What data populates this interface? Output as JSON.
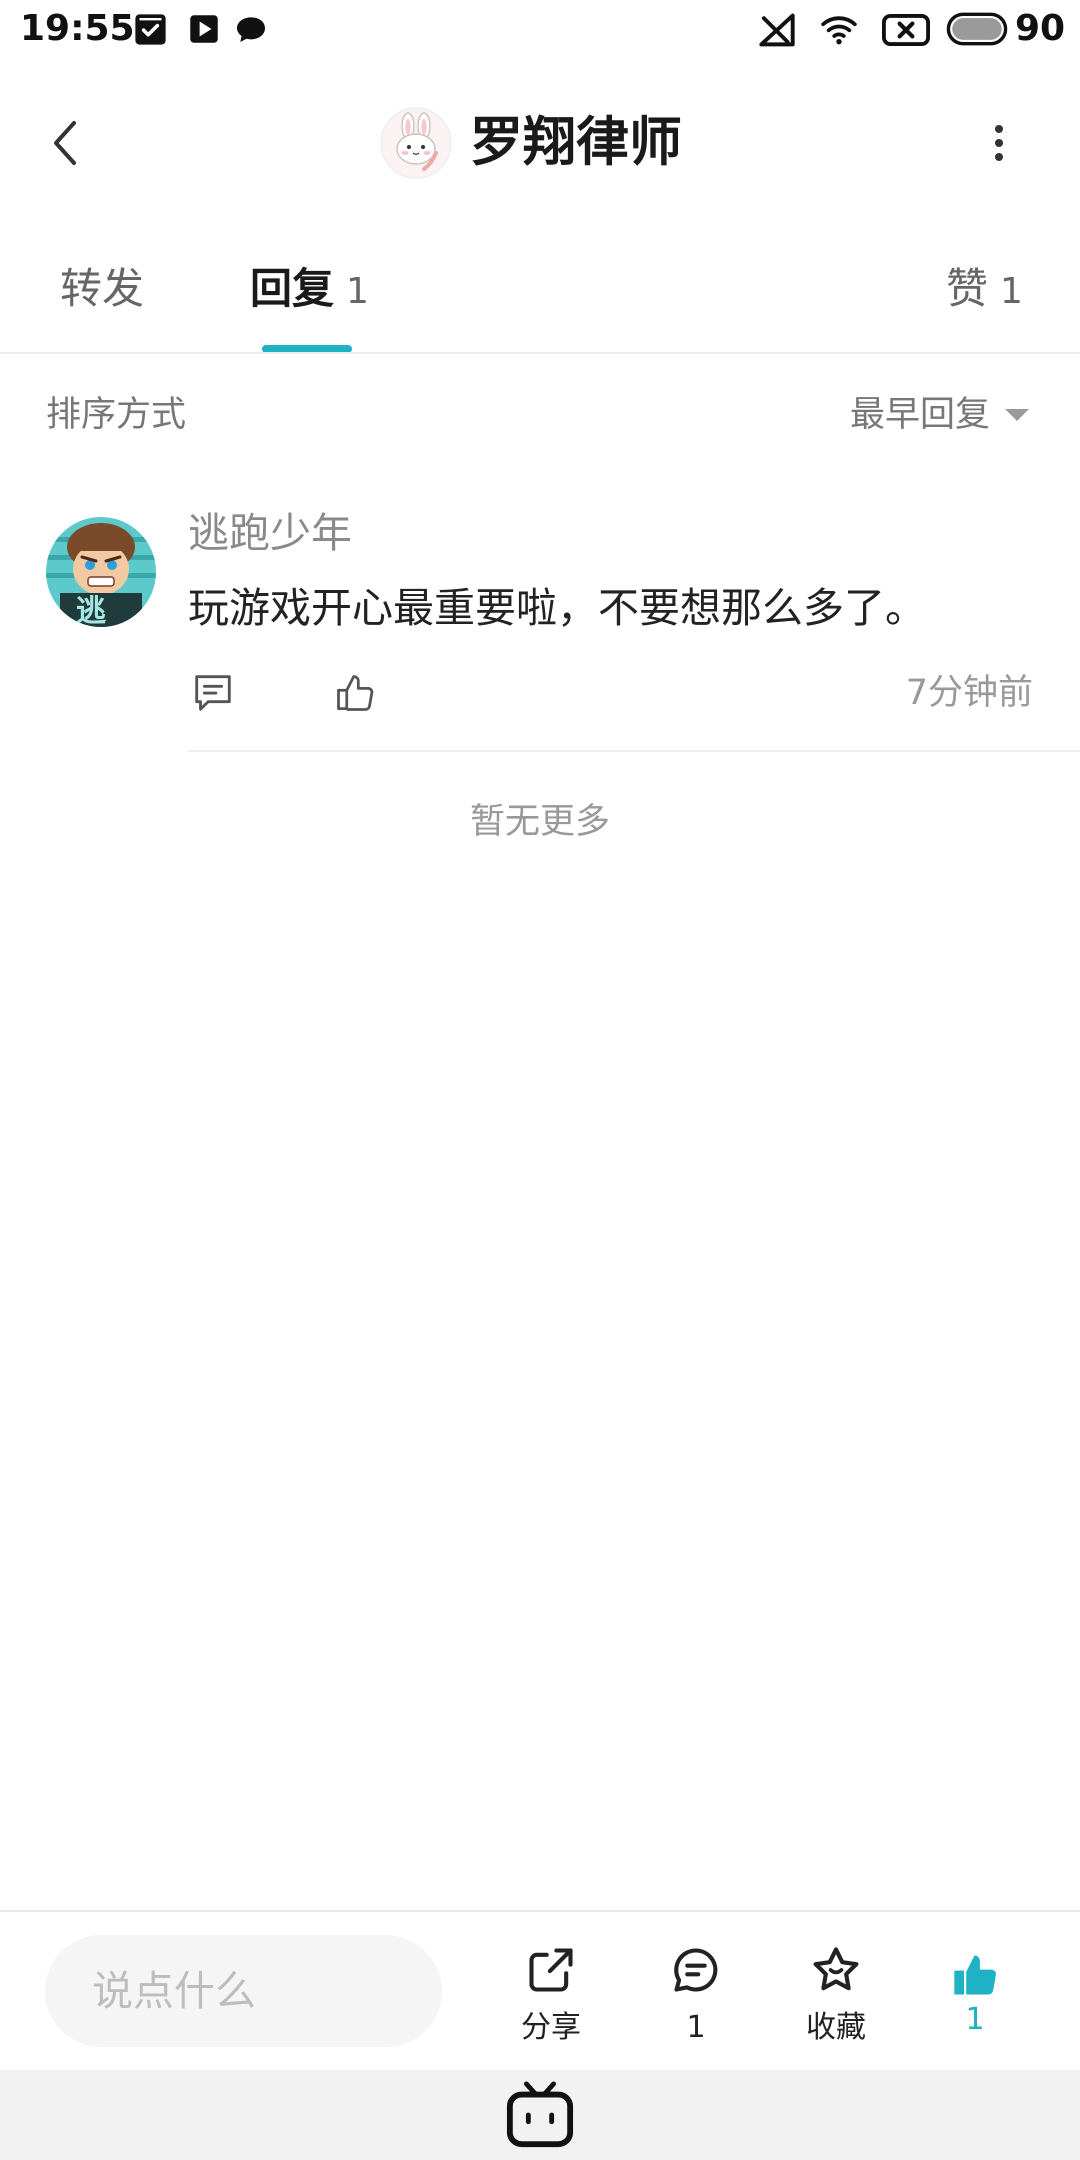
{
  "status_bar": {
    "time": "19:55",
    "battery_level": "90",
    "left_icons": [
      "notification-check-icon",
      "video-play-icon",
      "chat-bubble-icon"
    ],
    "right_icons": [
      "no-signal-icon",
      "wifi-icon",
      "no-sim-icon",
      "battery-icon"
    ]
  },
  "header": {
    "title": "罗翔律师",
    "back_icon": "back-arrow-icon",
    "more_icon": "more-vertical-icon"
  },
  "tabs": [
    {
      "label": "转发",
      "active": false
    },
    {
      "label": "回复",
      "count": "1",
      "active": true
    },
    {
      "label": "赞",
      "count": "1",
      "active": false
    }
  ],
  "sort": {
    "label": "排序方式",
    "selected": "最早回复"
  },
  "comments": [
    {
      "username": "逃跑少年",
      "avatar_text": "逃",
      "text": "玩游戏开心最重要啦，不要想那么多了。",
      "time": "7分钟前"
    }
  ],
  "end_text": "暂无更多",
  "bottom_bar": {
    "input_placeholder": "说点什么",
    "share_label": "分享",
    "comment_count": "1",
    "favorite_label": "收藏",
    "like_count": "1",
    "like_active": true
  },
  "colors": {
    "accent": "#1eb2c4",
    "text_primary": "#222222",
    "text_secondary": "#888888",
    "divider": "#eeeeee"
  }
}
